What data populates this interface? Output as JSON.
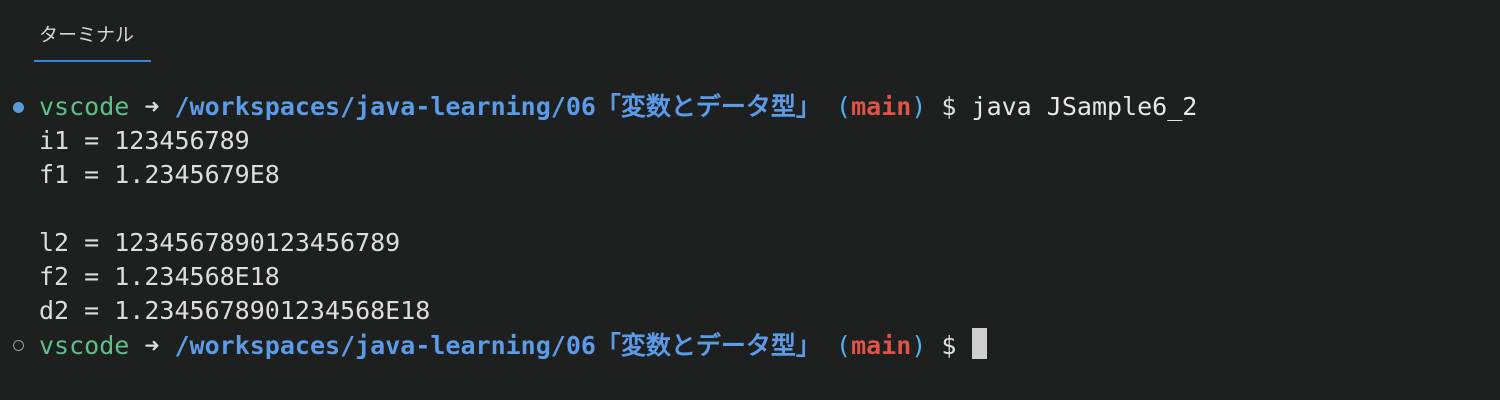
{
  "tab": {
    "label": "ターミナル"
  },
  "prompt": {
    "user": "vscode",
    "arrow": "➜",
    "path": "/workspaces/java-learning/06「変数とデータ型」",
    "paren_open": "(",
    "branch": "main",
    "paren_close": ")",
    "dollar": "$"
  },
  "command": "java JSample6_2",
  "output": {
    "line1": "i1 = 123456789",
    "line2": "f1 = 1.2345679E8",
    "line3": "l2 = 1234567890123456789",
    "line4": "f2 = 1.234568E18",
    "line5": "d2 = 1.2345678901234568E18"
  },
  "colors": {
    "background": "#1e1f1f",
    "user": "#5dc08a",
    "path": "#5b9be8",
    "branch": "#e0524a",
    "paren": "#4fb2e8",
    "tab_underline": "#3b84d6",
    "status_dot_success": "#5a9bd6",
    "status_dot_idle": "#9a9a9a"
  },
  "icons": {
    "status_success": "filled-circle-icon",
    "status_idle": "hollow-circle-icon",
    "cursor": "block-cursor"
  }
}
